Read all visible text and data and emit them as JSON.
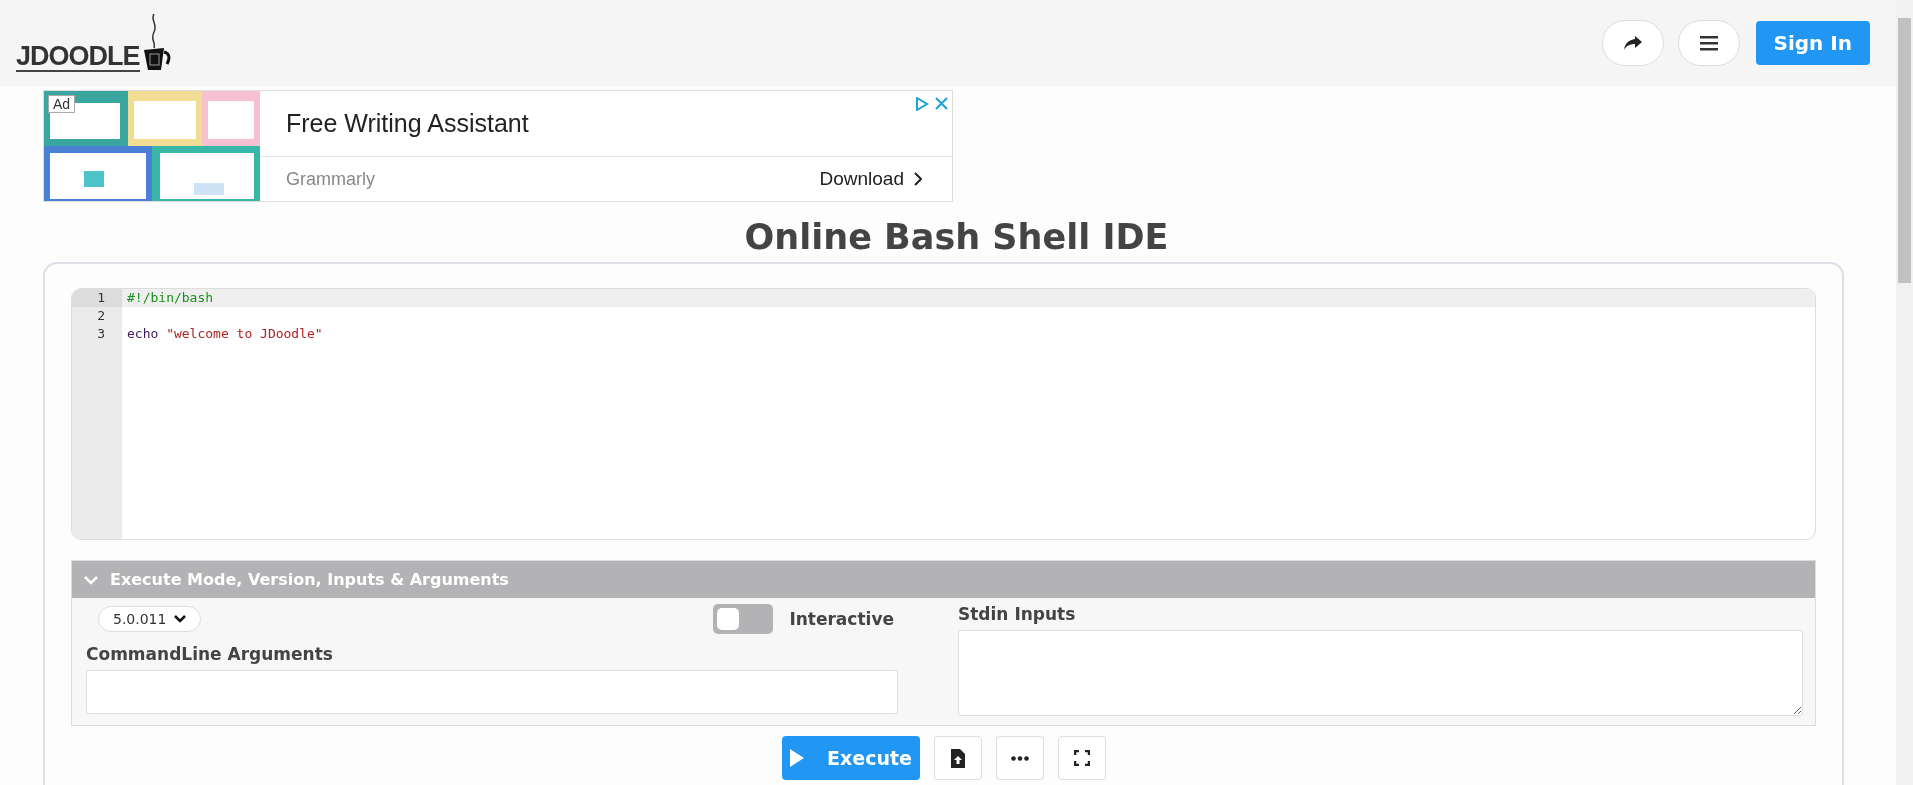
{
  "header": {
    "logo": "JDOODLE",
    "sign_in": "Sign In"
  },
  "ad": {
    "badge": "Ad",
    "headline": "Free Writing Assistant",
    "advertiser": "Grammarly",
    "cta": "Download"
  },
  "title": "Online Bash Shell IDE",
  "editor": {
    "lines": [
      {
        "number": "1",
        "active": true,
        "tokens": [
          {
            "kind": "comment",
            "text": "#!/bin/bash"
          }
        ]
      },
      {
        "number": "2",
        "active": false
      },
      {
        "number": "3",
        "active": false,
        "tokens": [
          {
            "kind": "plain",
            "text": "echo "
          },
          {
            "kind": "string",
            "text": "\"welcome to JDoodle\""
          }
        ]
      }
    ]
  },
  "options": {
    "heading": "Execute Mode, Version, Inputs & Arguments",
    "expanded": true,
    "version": "5.0.011",
    "interactive": {
      "label": "Interactive",
      "on": false
    },
    "args_label": "CommandLine Arguments",
    "stdin_label": "Stdin Inputs"
  },
  "actions": {
    "execute": "Execute"
  }
}
